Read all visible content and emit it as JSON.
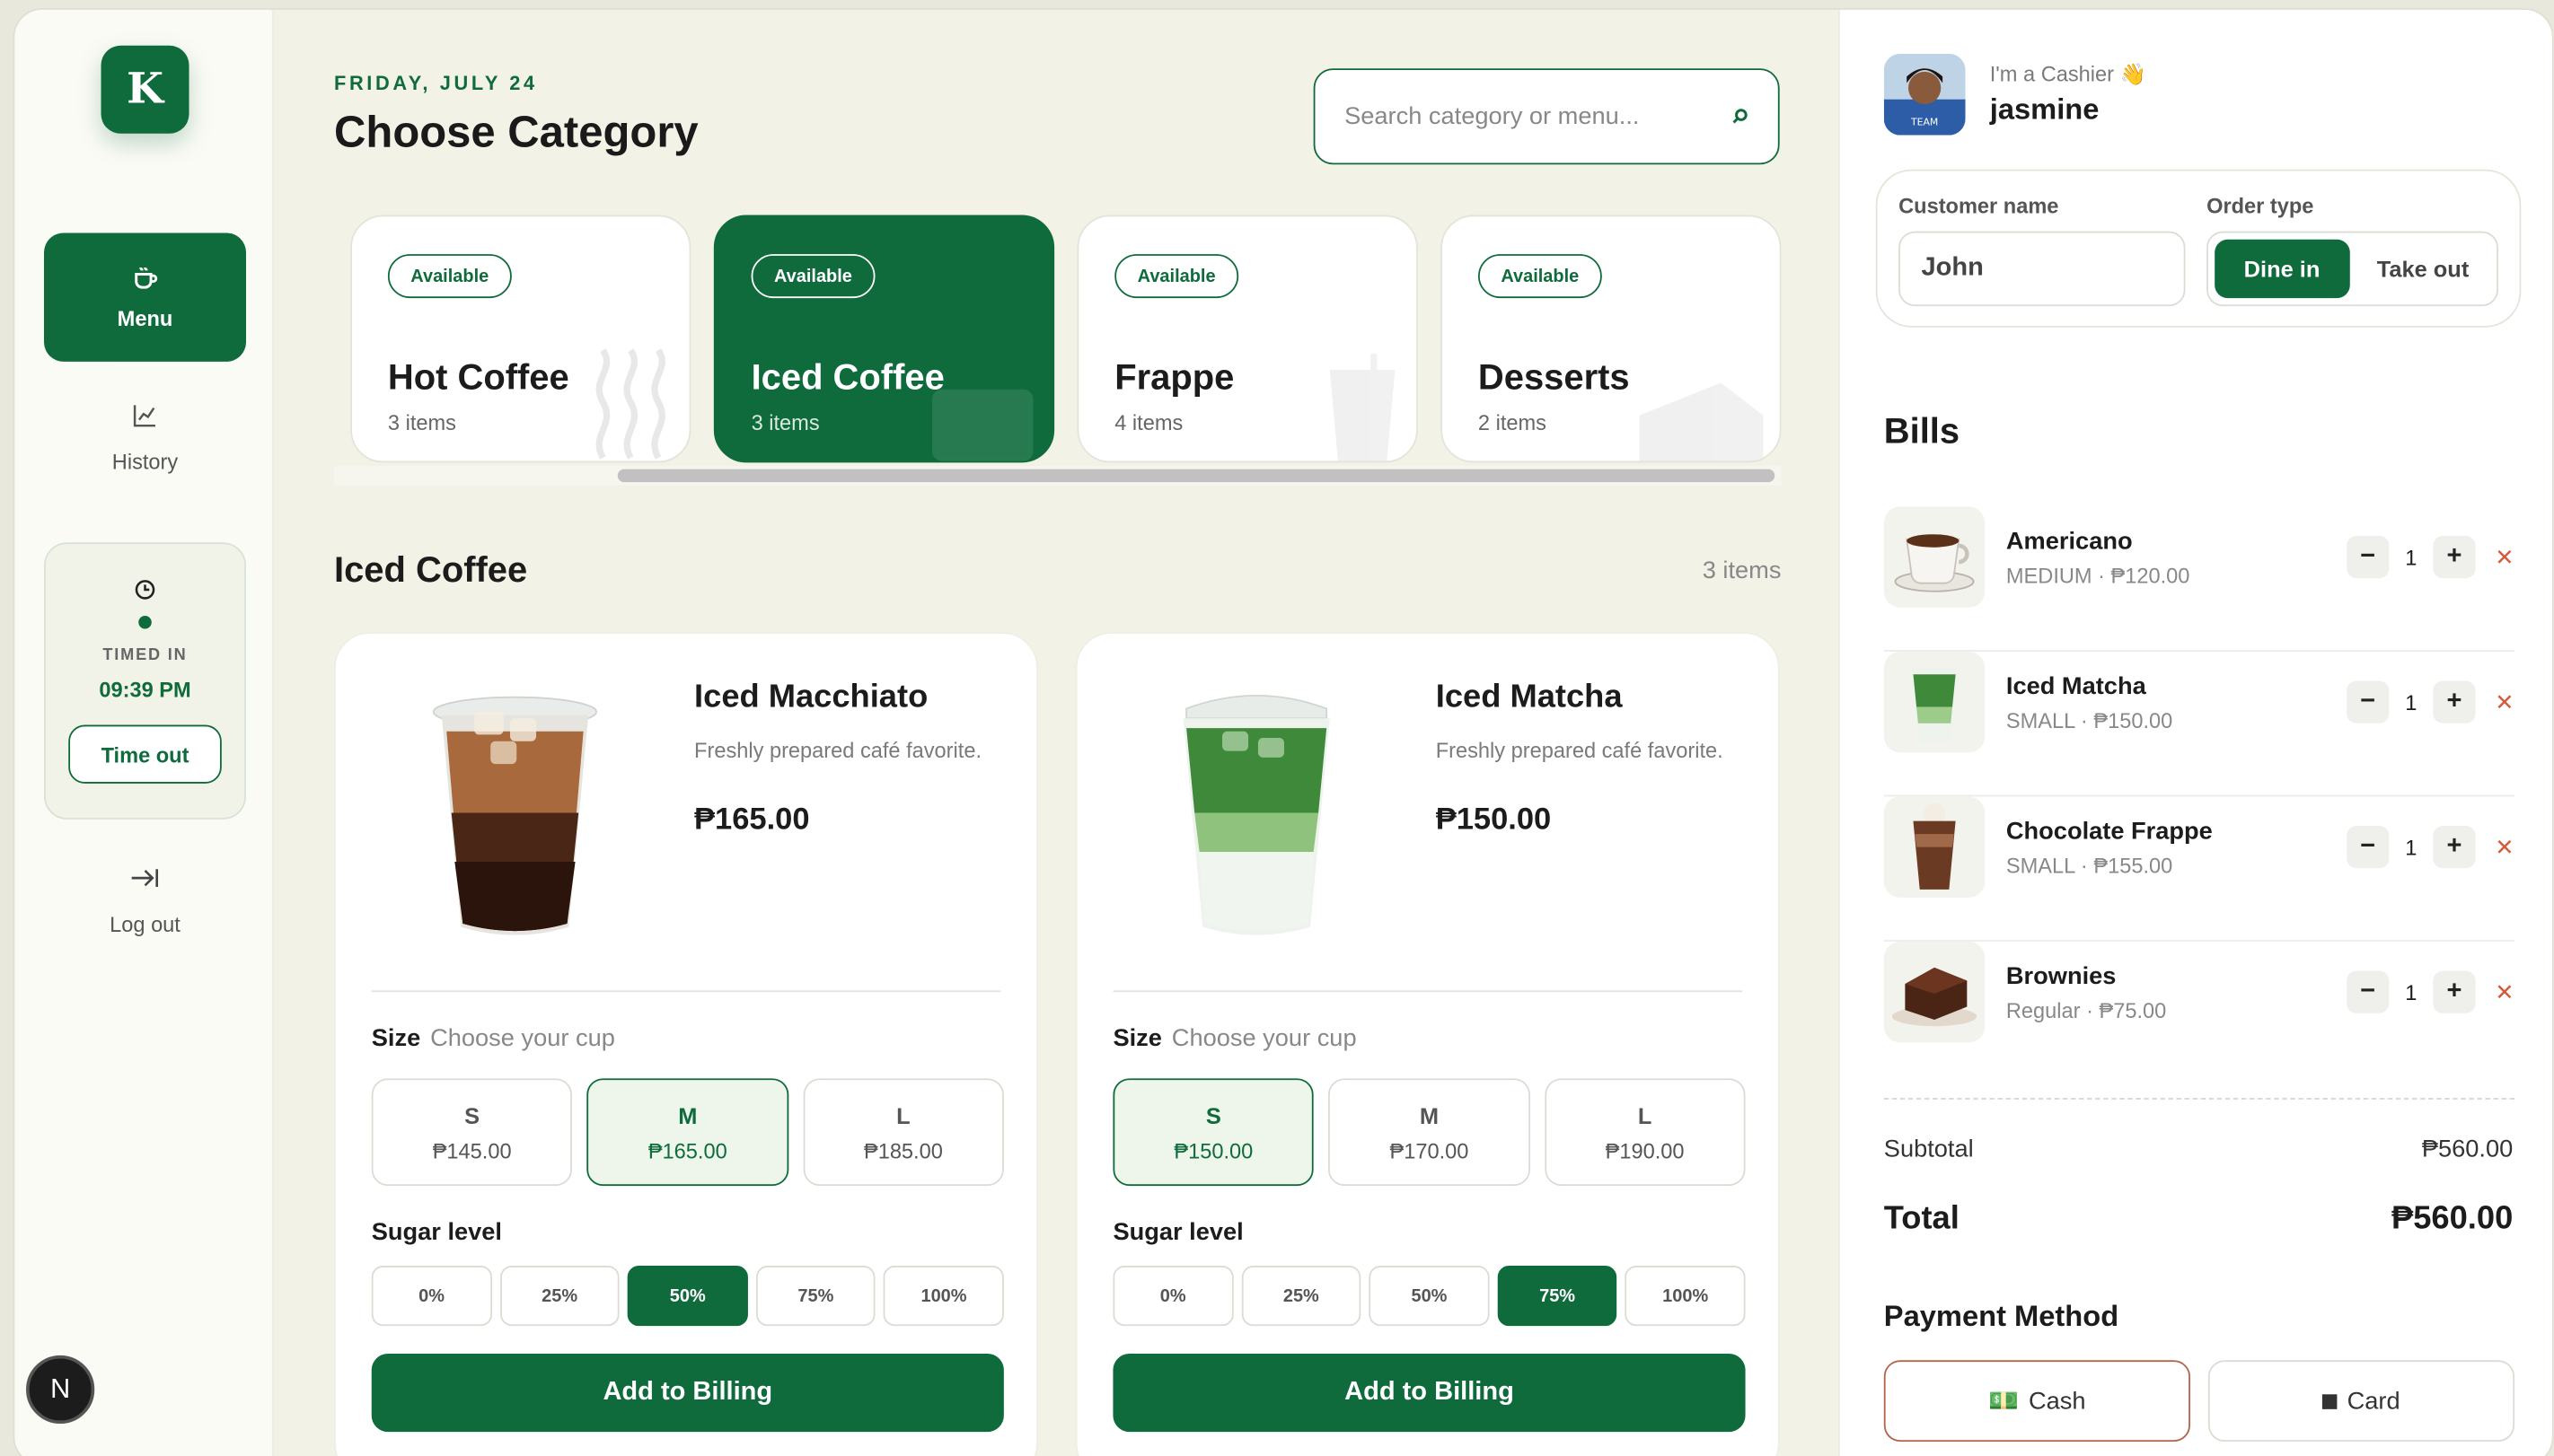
{
  "brand": {
    "logo_letter": "K"
  },
  "nav": {
    "menu_label": "Menu",
    "history_label": "History",
    "timed_in_label": "TIMED IN",
    "timed_in_time": "09:39 PM",
    "time_out_label": "Time out",
    "logout_label": "Log out",
    "badge_letter": "N"
  },
  "header": {
    "date": "FRIDAY, JULY 24",
    "title": "Choose Category",
    "search_placeholder": "Search category or menu..."
  },
  "categories": [
    {
      "badge": "Available",
      "name": "Hot Coffee",
      "count": "3 items",
      "active": false
    },
    {
      "badge": "Available",
      "name": "Iced Coffee",
      "count": "3 items",
      "active": true
    },
    {
      "badge": "Available",
      "name": "Frappe",
      "count": "4 items",
      "active": false
    },
    {
      "badge": "Available",
      "name": "Desserts",
      "count": "2 items",
      "active": false
    }
  ],
  "section": {
    "title": "Iced Coffee",
    "count": "3 items"
  },
  "products": [
    {
      "name": "Iced Macchiato",
      "desc": "Freshly prepared café favorite.",
      "price": "₱165.00",
      "size_label": "Size",
      "size_hint": "Choose your cup",
      "sizes": [
        {
          "label": "S",
          "price": "₱145.00"
        },
        {
          "label": "M",
          "price": "₱165.00"
        },
        {
          "label": "L",
          "price": "₱185.00"
        }
      ],
      "selected_size": "M",
      "sugar_label": "Sugar level",
      "sugars": [
        "0%",
        "25%",
        "50%",
        "75%",
        "100%"
      ],
      "selected_sugar": "50%",
      "add_label": "Add to Billing"
    },
    {
      "name": "Iced Matcha",
      "desc": "Freshly prepared café favorite.",
      "price": "₱150.00",
      "size_label": "Size",
      "size_hint": "Choose your cup",
      "sizes": [
        {
          "label": "S",
          "price": "₱150.00"
        },
        {
          "label": "M",
          "price": "₱170.00"
        },
        {
          "label": "L",
          "price": "₱190.00"
        }
      ],
      "selected_size": "S",
      "sugar_label": "Sugar level",
      "sugars": [
        "0%",
        "25%",
        "50%",
        "75%",
        "100%"
      ],
      "selected_sugar": "75%",
      "add_label": "Add to Billing"
    }
  ],
  "cashier": {
    "role": "I'm a Cashier 👋",
    "name": "jasmine"
  },
  "order": {
    "customer_label": "Customer name",
    "customer_value": "John",
    "type_label": "Order type",
    "dine_in": "Dine in",
    "take_out": "Take out"
  },
  "bills": {
    "title": "Bills",
    "items": [
      {
        "name": "Americano",
        "sub": "MEDIUM · ₱120.00",
        "qty": "1"
      },
      {
        "name": "Iced Matcha",
        "sub": "SMALL · ₱150.00",
        "qty": "1"
      },
      {
        "name": "Chocolate Frappe",
        "sub": "SMALL · ₱155.00",
        "qty": "1"
      },
      {
        "name": "Brownies",
        "sub": "Regular · ₱75.00",
        "qty": "1"
      }
    ],
    "subtotal_label": "Subtotal",
    "subtotal_value": "₱560.00",
    "total_label": "Total",
    "total_value": "₱560.00"
  },
  "payment": {
    "title": "Payment Method",
    "cash": "Cash",
    "card": "Card"
  },
  "colors": {
    "accent": "#0f6b3c",
    "background": "#f3f2e6",
    "remove": "#d35a3a"
  }
}
